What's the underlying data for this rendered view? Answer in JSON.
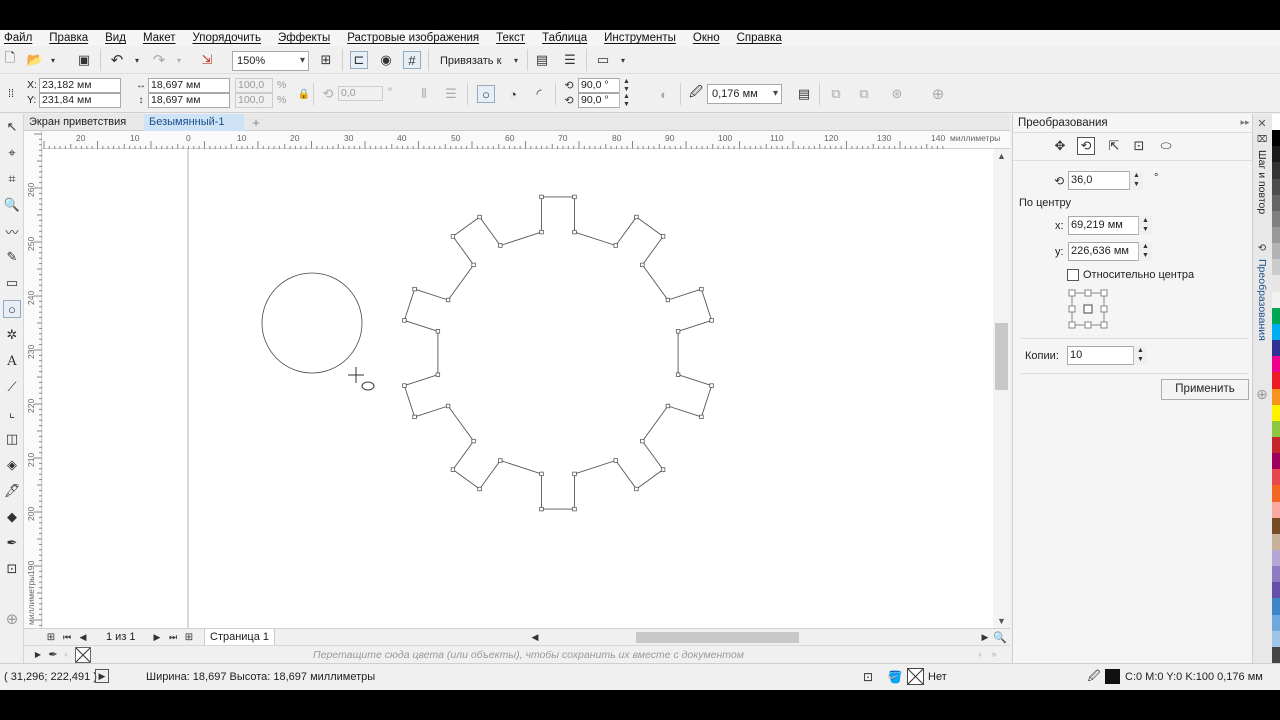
{
  "menu": [
    "Файл",
    "Правка",
    "Вид",
    "Макет",
    "Упорядочить",
    "Эффекты",
    "Растровые изображения",
    "Текст",
    "Таблица",
    "Инструменты",
    "Окно",
    "Справка"
  ],
  "toolbar": {
    "zoom": "150%",
    "snap_label": "Привязать к"
  },
  "property_bar": {
    "x_label": "X:",
    "x_value": "23,182 мм",
    "y_label": "Y:",
    "y_value": "231,84 мм",
    "width_value": "18,697 мм",
    "height_value": "18,697 мм",
    "scale_x": "100,0",
    "scale_y": "100,0",
    "percent": "%",
    "rotation": "0,0",
    "degree": "°",
    "arc_start": "90,0 °",
    "arc_end": "90,0 °",
    "outline_width": "0,176 мм"
  },
  "tabs": {
    "welcome": "Экран приветствия",
    "document": "Безымянный-1"
  },
  "ruler": {
    "h_ticks": [
      "20",
      "10",
      "0",
      "10",
      "20",
      "30",
      "40",
      "50",
      "60",
      "70",
      "80",
      "90",
      "100",
      "110",
      "120",
      "130",
      "140"
    ],
    "units": "миллиметры",
    "v_ticks": [
      "260",
      "250",
      "240",
      "230",
      "220",
      "210",
      "200",
      "190"
    ],
    "v_units": "миллиметры"
  },
  "page_nav": {
    "counter": "1 из 1",
    "page_tab": "Страница 1"
  },
  "palette_hint": "Перетащите сюда цвета (или объекты), чтобы сохранить их вместе с документом",
  "docker": {
    "title": "Преобразования",
    "angle": "36,0",
    "degree": "°",
    "center_label": "По центру",
    "x_label": "x:",
    "x_value": "69,219 мм",
    "y_label": "y:",
    "y_value": "226,636 мм",
    "relative_label": "Относительно центра",
    "copies_label": "Копии:",
    "copies_value": "10",
    "apply_label": "Применить"
  },
  "vertical_tabs": [
    "Шаг и повтор",
    "Преобразования"
  ],
  "status": {
    "cursor": "( 31,296; 222,491 )",
    "size": "Ширина: 18,697  Высота: 18,697  миллиметры",
    "fill": "Нет",
    "outline": "C:0 M:0 Y:0 K:100  0,176 мм"
  },
  "colors": {
    "accent": "#cfe3f7",
    "palette": [
      "#ffffff",
      "#000000",
      "#1a1a1a",
      "#333333",
      "#4d4d4d",
      "#666666",
      "#808080",
      "#999999",
      "#b3b3b3",
      "#cccccc",
      "#e6e6e6",
      "#f2f2f2",
      "#00a651",
      "#00aeef",
      "#2e3192",
      "#ec008c",
      "#ed1c24",
      "#f7941d",
      "#fff200",
      "#8dc63f",
      "#c1272d",
      "#9e005d",
      "#e5484d",
      "#f26522",
      "#f9a99f",
      "#754c24",
      "#c7b299",
      "#b4a7d6",
      "#8e7cc3",
      "#674ea7",
      "#3d85c6",
      "#6fa8dc",
      "#9fc5e8",
      "#444444"
    ]
  }
}
